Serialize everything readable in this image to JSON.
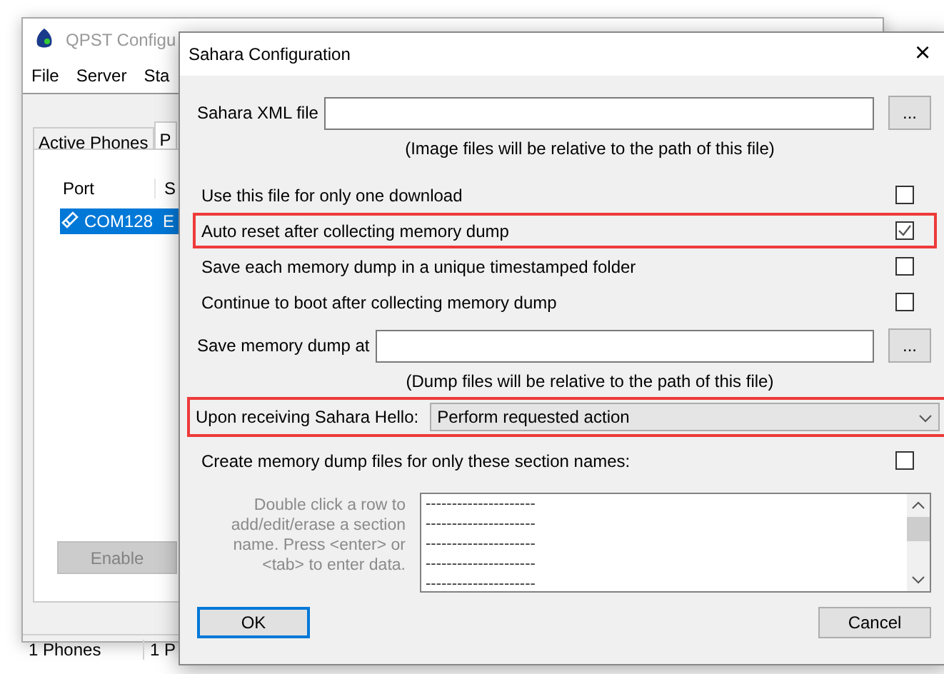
{
  "background_window": {
    "title": "QPST Configu",
    "menu": [
      "File",
      "Server",
      "Sta"
    ],
    "tabs": [
      {
        "label": "Active Phones",
        "selected": false
      },
      {
        "label": "P",
        "selected": true
      }
    ],
    "table": {
      "columns": [
        "Port",
        "S"
      ],
      "rows": [
        {
          "cells": [
            "COM128",
            "E"
          ],
          "selected": true
        }
      ]
    },
    "enable_button": {
      "label": "Enable",
      "disabled": true
    },
    "status_bar": [
      "1 Phones",
      "1 P"
    ]
  },
  "dialog": {
    "title": "Sahara Configuration",
    "close": "×",
    "xml_file": {
      "label": "Sahara XML file",
      "browse": "...",
      "note": "(Image files will be relative to the path of this file)"
    },
    "options": [
      {
        "label": "Use this file for only one download",
        "checked": false,
        "highlighted": false
      },
      {
        "label": "Auto reset after collecting memory dump",
        "checked": true,
        "highlighted": true
      },
      {
        "label": "Save each memory dump in a unique timestamped folder",
        "checked": false,
        "highlighted": false
      },
      {
        "label": "Continue to boot after collecting memory dump",
        "checked": false,
        "highlighted": false
      }
    ],
    "dump_path": {
      "label": "Save memory dump at",
      "browse": "...",
      "note": "(Dump files will be relative to the path of this file)"
    },
    "hello": {
      "label": "Upon receiving Sahara Hello:",
      "value": "Perform requested action",
      "highlighted": true
    },
    "section_filter": {
      "label": "Create memory dump files for only these section names:",
      "checked": false,
      "hint": "Double click a row to add/edit/erase a section name. Press <enter> or <tab> to enter data.",
      "rows": [
        "---------------------",
        "---------------------",
        "---------------------",
        "---------------------",
        "---------------------"
      ]
    },
    "buttons": [
      {
        "label": "OK",
        "default": true
      },
      {
        "label": "Cancel",
        "default": false
      }
    ]
  }
}
